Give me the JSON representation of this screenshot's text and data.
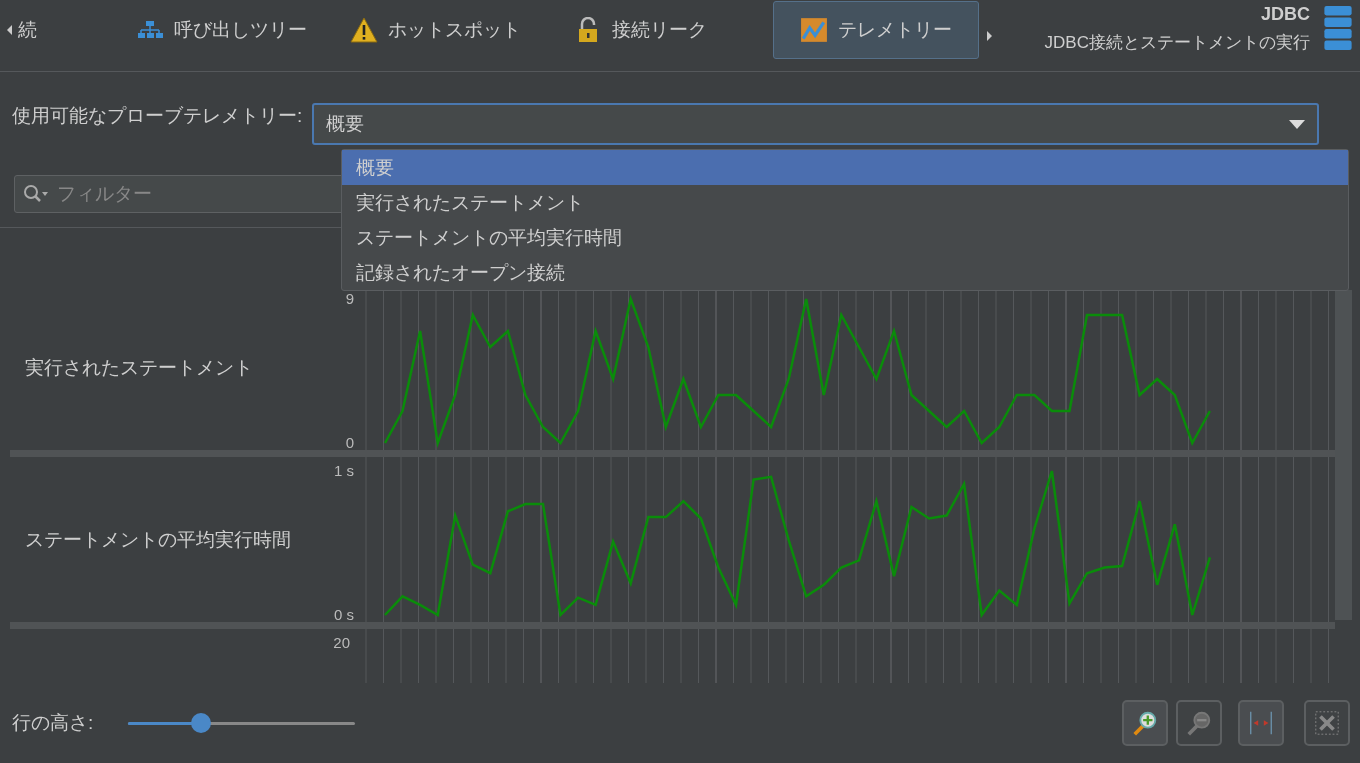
{
  "tabs": [
    {
      "label": "続",
      "kind": "back",
      "selected": false
    },
    {
      "label": "呼び出しツリー",
      "kind": "tree",
      "selected": false
    },
    {
      "label": "ホットスポット",
      "kind": "warning",
      "selected": false
    },
    {
      "label": "接続リーク",
      "kind": "lock",
      "selected": false
    },
    {
      "label": "テレメトリー",
      "kind": "chart",
      "selected": true
    }
  ],
  "header": {
    "title": "JDBC",
    "subtitle": "JDBC接続とステートメントの実行"
  },
  "probe_select": {
    "label": "使用可能なプローブテレメトリー:",
    "value": "概要",
    "expanded": true,
    "options": [
      {
        "label": "概要",
        "selected": true
      },
      {
        "label": "実行されたステートメント",
        "selected": false
      },
      {
        "label": "ステートメントの平均実行時間",
        "selected": false
      },
      {
        "label": "記録されたオープン接続",
        "selected": false
      }
    ]
  },
  "filter": {
    "placeholder": "フィルター"
  },
  "telemetries": [
    {
      "label": "実行されたステートメント",
      "chart_data": {
        "type": "line",
        "grid": true,
        "ylim": [
          0,
          9
        ],
        "yticks": [
          {
            "value": 0,
            "label": "0"
          },
          {
            "value": 9,
            "label": "9"
          }
        ],
        "series": [
          {
            "color": "#0a8c0a",
            "values": [
              0,
              2,
              7,
              0,
              3,
              8,
              6,
              7,
              3,
              1,
              0,
              2,
              7,
              4,
              9,
              6,
              1,
              4,
              1,
              3,
              3,
              2,
              1,
              4,
              9,
              3,
              8,
              6,
              4,
              7,
              3,
              2,
              1,
              2,
              0,
              1,
              3,
              3,
              2,
              2,
              8,
              8,
              8,
              3,
              4,
              3,
              0,
              2
            ]
          }
        ]
      }
    },
    {
      "label": "ステートメントの平均実行時間",
      "chart_data": {
        "type": "line",
        "grid": true,
        "ylim": [
          0,
          1
        ],
        "yticks": [
          {
            "value": 0,
            "label": "0 s"
          },
          {
            "value": 1,
            "label": "1 s"
          }
        ],
        "series": [
          {
            "color": "#0a8c0a",
            "values": [
              0,
              0.13,
              0.07,
              0,
              0.69,
              0.35,
              0.29,
              0.72,
              0.77,
              0.77,
              0,
              0.12,
              0.07,
              0.51,
              0.22,
              0.68,
              0.68,
              0.79,
              0.67,
              0.33,
              0.07,
              0.94,
              0.96,
              0.52,
              0.13,
              0.21,
              0.33,
              0.38,
              0.79,
              0.27,
              0.75,
              0.67,
              0.69,
              0.91,
              0,
              0.17,
              0.07,
              0.6,
              1,
              0.08,
              0.29,
              0.33,
              0.34,
              0.79,
              0.21,
              0.63,
              0,
              0.4
            ]
          }
        ]
      }
    },
    {
      "tick_label": "20"
    }
  ],
  "row_height": {
    "label": "行の高さ:",
    "level": 0.33
  },
  "buttons": [
    {
      "kind": "zoom-in",
      "disabled": false
    },
    {
      "kind": "zoom-out",
      "disabled": true
    },
    {
      "kind": "fit",
      "disabled": false
    },
    {
      "kind": "remove",
      "disabled": true
    }
  ]
}
